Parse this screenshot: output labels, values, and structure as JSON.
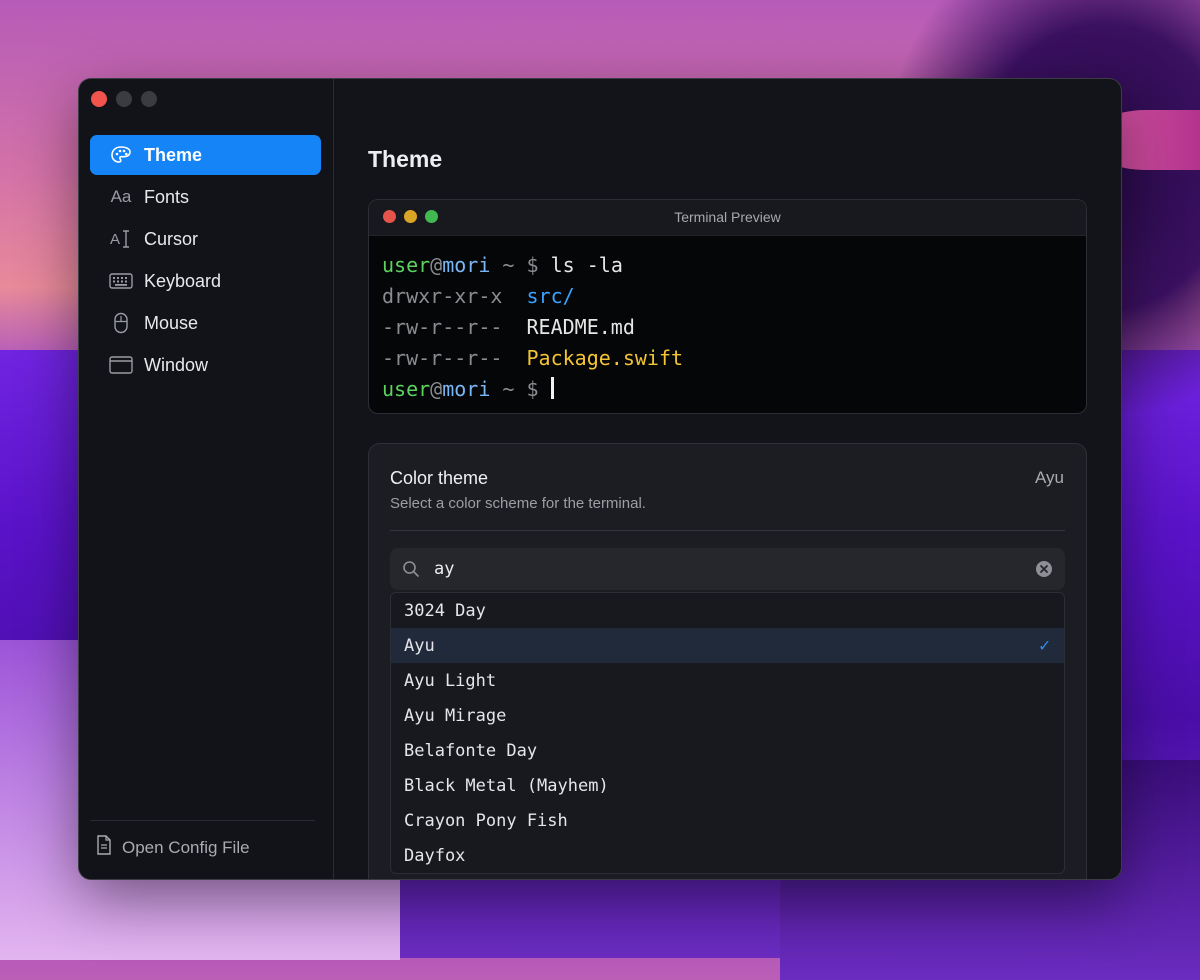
{
  "sidebar": {
    "items": [
      {
        "label": "Theme",
        "icon": "palette-icon",
        "active": true
      },
      {
        "label": "Fonts",
        "icon": "Aa",
        "active": false
      },
      {
        "label": "Cursor",
        "icon": "cursor-icon",
        "active": false
      },
      {
        "label": "Keyboard",
        "icon": "keyboard-icon",
        "active": false
      },
      {
        "label": "Mouse",
        "icon": "mouse-icon",
        "active": false
      },
      {
        "label": "Window",
        "icon": "window-icon",
        "active": false
      }
    ],
    "open_config": "Open Config File"
  },
  "main": {
    "title": "Theme",
    "preview": {
      "title": "Terminal Preview",
      "line1": {
        "user": "user",
        "at": "@",
        "host": "mori",
        "tilde": " ~ ",
        "dollar": "$ ",
        "cmd": "ls -la"
      },
      "line2": {
        "perm": "drwxr-xr-x  ",
        "name": "src/"
      },
      "line3": {
        "perm": "-rw-r--r--  ",
        "name": "README.md"
      },
      "line4": {
        "perm": "-rw-r--r--  ",
        "name": "Package.swift"
      },
      "line5": {
        "user": "user",
        "at": "@",
        "host": "mori",
        "tilde": " ~ ",
        "dollar": "$ "
      }
    },
    "color_theme": {
      "title": "Color theme",
      "subtitle": "Select a color scheme for the terminal.",
      "value": "Ayu",
      "search_value": "ay",
      "options": [
        {
          "label": "3024 Day",
          "selected": false
        },
        {
          "label": "Ayu",
          "selected": true
        },
        {
          "label": "Ayu Light",
          "selected": false
        },
        {
          "label": "Ayu Mirage",
          "selected": false
        },
        {
          "label": "Belafonte Day",
          "selected": false
        },
        {
          "label": "Black Metal (Mayhem)",
          "selected": false
        },
        {
          "label": "Crayon Pony Fish",
          "selected": false
        },
        {
          "label": "Dayfox",
          "selected": false
        }
      ]
    }
  },
  "colors": {
    "accent": "#1484f6",
    "window_bg": "#121419",
    "card_bg": "#1b1d22",
    "terminal_bg": "#050607"
  }
}
